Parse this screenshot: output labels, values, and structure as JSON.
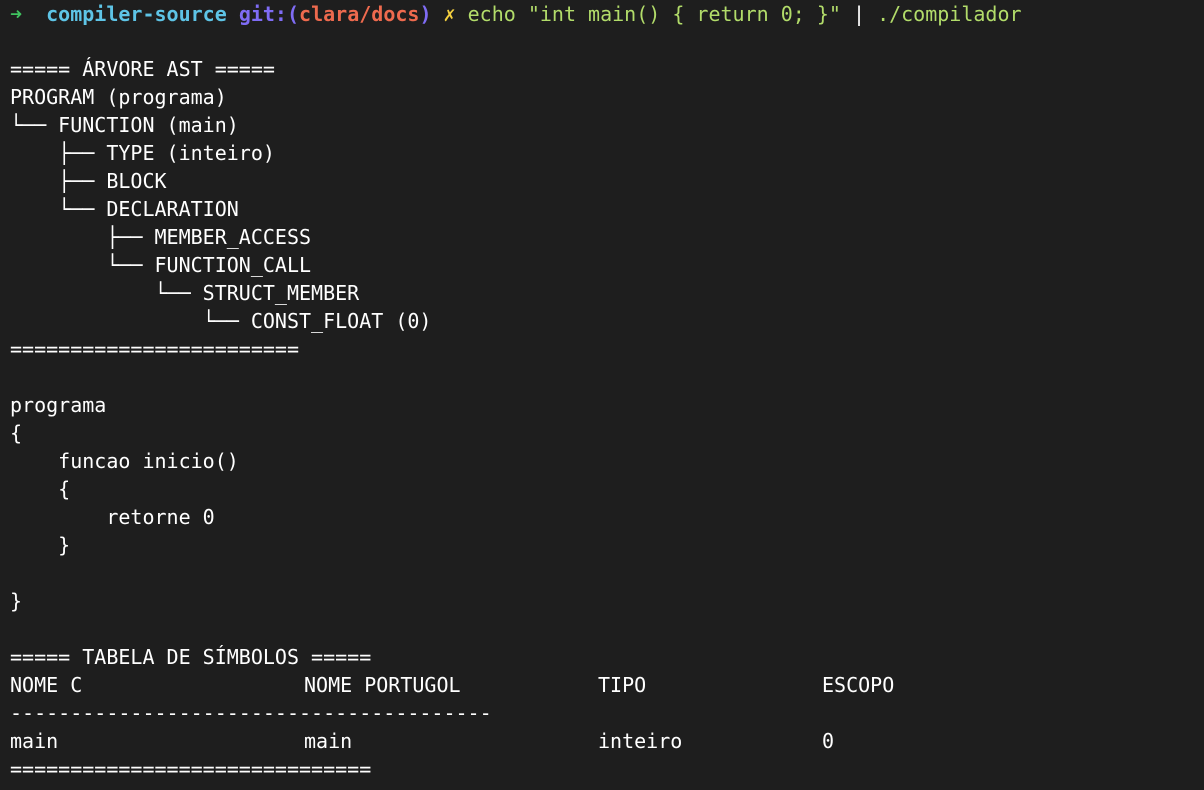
{
  "prompt": {
    "arrow": "➜",
    "directory": "compiler-source",
    "git_prefix": "git:(",
    "branch": "clara/docs",
    "git_suffix": ")",
    "dirty_mark": "✗",
    "command": "echo \"int main() { return 0; }\"",
    "pipe": "|",
    "program": "./compilador"
  },
  "ast": {
    "header": "===== ÁRVORE AST =====",
    "lines": [
      "PROGRAM (programa)",
      "└── FUNCTION (main)",
      "    ├── TYPE (inteiro)",
      "    ├── BLOCK",
      "    └── DECLARATION",
      "        ├── MEMBER_ACCESS",
      "        └── FUNCTION_CALL",
      "            └── STRUCT_MEMBER",
      "                └── CONST_FLOAT (0)"
    ],
    "footer": "========================"
  },
  "output_code": {
    "lines": [
      "programa",
      "{",
      "    funcao inicio()",
      "    {",
      "        retorne 0",
      "    }",
      "",
      "}"
    ]
  },
  "symbol_table": {
    "header": "===== TABELA DE SÍMBOLOS =====",
    "columns": [
      "NOME C",
      "NOME PORTUGOL",
      "TIPO",
      "ESCOPO"
    ],
    "separator": "----------------------------------------",
    "rows": [
      [
        "main",
        "main",
        "inteiro",
        "0"
      ]
    ],
    "footer": "=============================="
  },
  "colors": {
    "background": "#1e1e1e",
    "text": "#ffffff",
    "arrow": "#3fc35f",
    "directory": "#5ec4e6",
    "git": "#7f6cf5",
    "branch": "#ee6a4e",
    "dirty": "#f4d03f",
    "command": "#b2dc6a"
  }
}
